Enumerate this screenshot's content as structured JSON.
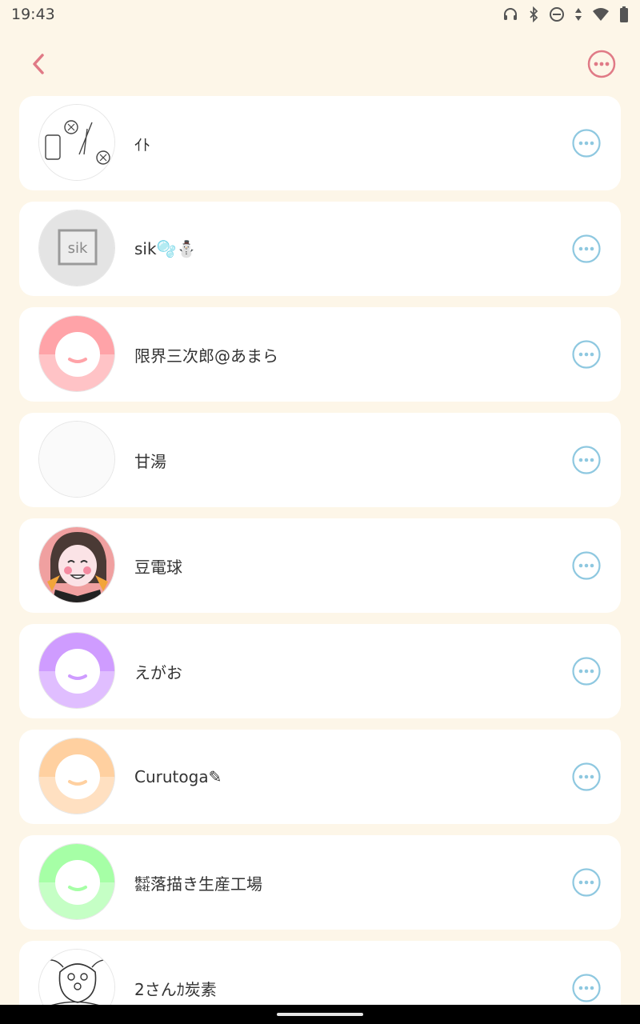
{
  "status": {
    "time": "19:43",
    "icons": [
      "headphones-icon",
      "bluetooth-icon",
      "dnd-icon",
      "data-arrows-icon",
      "wifi-icon",
      "battery-icon"
    ]
  },
  "appbar": {
    "back_icon": "chevron-left-icon",
    "menu_icon": "more-circle-icon",
    "accent": "#e07a86"
  },
  "colors": {
    "background": "#fdf6e8",
    "card": "#ffffff",
    "more_icon": "#8ec8e0"
  },
  "users": [
    {
      "name": "ｲﾄ",
      "avatar": "sketch-items"
    },
    {
      "name": "sik🫧⛄",
      "avatar": "sik-box"
    },
    {
      "name": "限界三次郎@あまら",
      "avatar": "default",
      "color": "#ffa3a8"
    },
    {
      "name": "甘湯",
      "avatar": "blank"
    },
    {
      "name": "豆電球",
      "avatar": "illustration"
    },
    {
      "name": "えがお",
      "avatar": "default",
      "color": "#cf9cff"
    },
    {
      "name": "Curutoga✎",
      "avatar": "default",
      "color": "#ffd0a0"
    },
    {
      "name": "㍿落描き生産工場",
      "avatar": "default",
      "color": "#a6ffa6"
    },
    {
      "name": "2さんｶ炭素",
      "avatar": "sketch-creature"
    }
  ]
}
